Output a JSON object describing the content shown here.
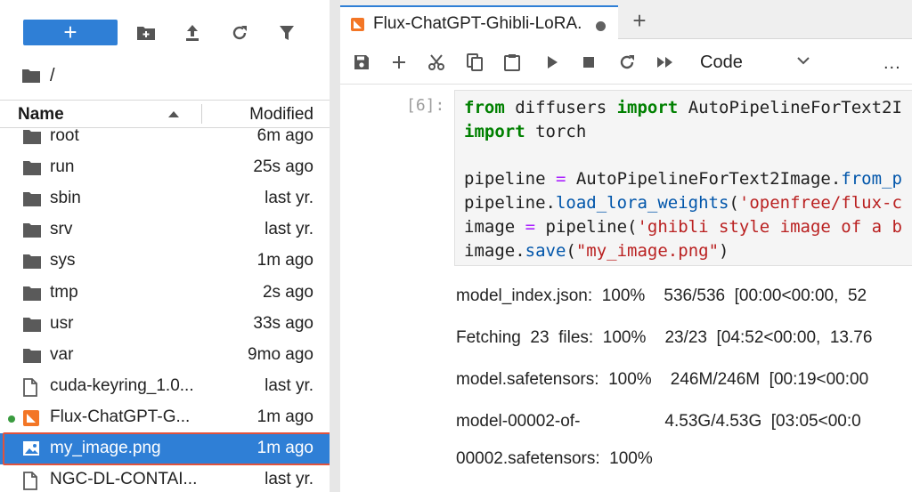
{
  "file_browser": {
    "new_button": "+",
    "toolbar": [
      {
        "name": "new-folder-icon"
      },
      {
        "name": "upload-icon"
      },
      {
        "name": "refresh-icon"
      },
      {
        "name": "filter-icon"
      }
    ],
    "breadcrumb": "/",
    "columns": {
      "name": "Name",
      "modified": "Modified"
    },
    "files": [
      {
        "name": "root",
        "modified": "6m ago",
        "icon": "folder-icon"
      },
      {
        "name": "run",
        "modified": "25s ago",
        "icon": "folder-icon"
      },
      {
        "name": "sbin",
        "modified": "last yr.",
        "icon": "folder-icon"
      },
      {
        "name": "srv",
        "modified": "last yr.",
        "icon": "folder-icon"
      },
      {
        "name": "sys",
        "modified": "1m ago",
        "icon": "folder-icon"
      },
      {
        "name": "tmp",
        "modified": "2s ago",
        "icon": "folder-icon"
      },
      {
        "name": "usr",
        "modified": "33s ago",
        "icon": "folder-icon"
      },
      {
        "name": "var",
        "modified": "9mo ago",
        "icon": "folder-icon"
      },
      {
        "name": "cuda-keyring_1.0...",
        "modified": "last yr.",
        "icon": "file-icon"
      },
      {
        "name": "Flux-ChatGPT-G...",
        "modified": "1m ago",
        "icon": "notebook-icon",
        "running": true
      },
      {
        "name": "my_image.png",
        "modified": "1m ago",
        "icon": "image-icon",
        "selected": true
      },
      {
        "name": "NGC-DL-CONTAI...",
        "modified": "last yr.",
        "icon": "file-icon"
      }
    ]
  },
  "notebook": {
    "tab_title": "Flux-ChatGPT-Ghibli-LoRA.",
    "tab_add": "+",
    "kernel": "Code",
    "more": "...",
    "cell_prompt": "[6]:",
    "code": {
      "l1_kw1": "from",
      "l1_mid": " diffusers ",
      "l1_kw2": "import",
      "l1_rest": " AutoPipelineForText2I",
      "l2_kw": "import",
      "l2_rest": " torch",
      "l4_a": "pipeline ",
      "l4_op": "=",
      "l4_b": " AutoPipelineForText2Image.",
      "l4_fn": "from_p",
      "l5_a": "pipeline.",
      "l5_fn": "load_lora_weights",
      "l5_b": "(",
      "l5_str": "'openfree/flux-c",
      "l6_a": "image ",
      "l6_op": "=",
      "l6_b": " pipeline(",
      "l6_str": "'ghibli style image of a b",
      "l7_a": "image.",
      "l7_fn": "save",
      "l7_b": "(",
      "l7_str": "\"my_image.png\"",
      "l7_c": ")"
    },
    "outputs": [
      "model_index.json:  100%    536/536  [00:00<00:00,  52",
      "Fetching  23  files:  100%    23/23  [04:52<00:00,  13.76",
      "model.safetensors:  100%    246M/246M  [00:19<00:00",
      "model-00002-of-                  4.53G/4.53G  [03:05<00:0",
      "00002.safetensors:  100%"
    ]
  },
  "colors": {
    "accent": "#2f7fd6",
    "selection_outline": "#e0533e",
    "running_dot": "#3a9b3f",
    "notebook_icon": "#f37626"
  }
}
